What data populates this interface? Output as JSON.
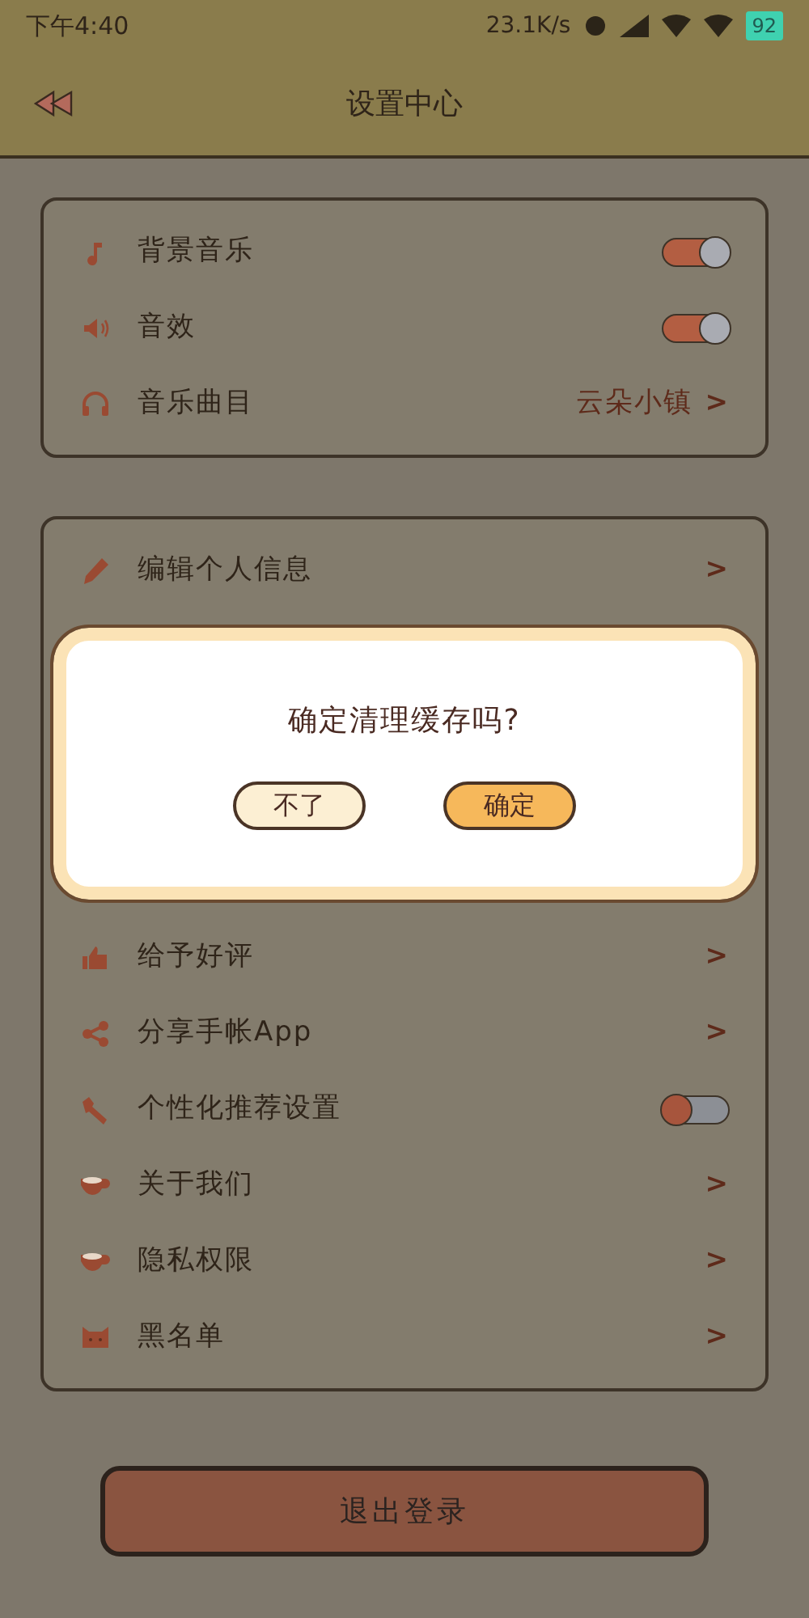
{
  "status_bar": {
    "time": "下午4:40",
    "network_speed": "23.1K/s",
    "battery": "92"
  },
  "header": {
    "title": "设置中心"
  },
  "audio_settings": [
    {
      "kind": "toggle",
      "label": "背景音乐",
      "on": true
    },
    {
      "kind": "toggle",
      "label": "音效",
      "on": true
    },
    {
      "kind": "link",
      "label": "音乐曲目",
      "value": "云朵小镇",
      "chevron": ">"
    }
  ],
  "account_settings_top": [
    {
      "kind": "link",
      "label": "编辑个人信息",
      "chevron": ">"
    }
  ],
  "dialog": {
    "message": "确定清理缓存吗?",
    "buttons": [
      {
        "label": "不了",
        "kind": "cancel"
      },
      {
        "label": "确定",
        "kind": "confirm"
      }
    ]
  },
  "account_settings_bottom": [
    {
      "kind": "link",
      "label": "给予好评",
      "chevron": ">"
    },
    {
      "kind": "link",
      "label": "分享手帐App",
      "chevron": ">"
    },
    {
      "kind": "toggle",
      "label": "个性化推荐设置",
      "on": false
    },
    {
      "kind": "link",
      "label": "关于我们",
      "chevron": ">"
    },
    {
      "kind": "link",
      "label": "隐私权限",
      "chevron": ">"
    },
    {
      "kind": "link",
      "label": "黑名单",
      "chevron": ">"
    }
  ],
  "logout_button": {
    "label": "退出登录"
  }
}
